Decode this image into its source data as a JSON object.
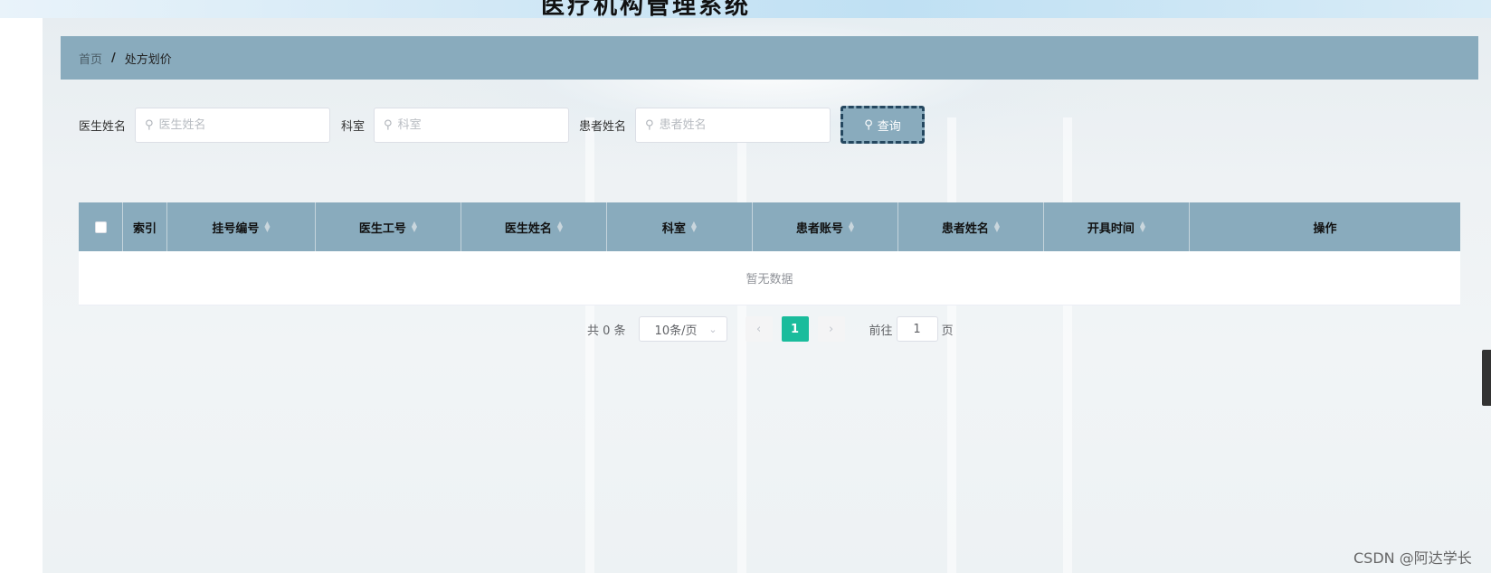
{
  "app": {
    "system_title": "医疗机构管理系统"
  },
  "breadcrumb": {
    "home": "首页",
    "separator": "/",
    "current": "处方划价"
  },
  "search": {
    "fields": [
      {
        "label": "医生姓名",
        "placeholder": "医生姓名",
        "value": ""
      },
      {
        "label": "科室",
        "placeholder": "科室",
        "value": ""
      },
      {
        "label": "患者姓名",
        "placeholder": "患者姓名",
        "value": ""
      }
    ],
    "query_button": "查询"
  },
  "table": {
    "columns": [
      {
        "label": "索引",
        "sortable": false
      },
      {
        "label": "挂号编号",
        "sortable": true
      },
      {
        "label": "医生工号",
        "sortable": true
      },
      {
        "label": "医生姓名",
        "sortable": true
      },
      {
        "label": "科室",
        "sortable": true
      },
      {
        "label": "患者账号",
        "sortable": true
      },
      {
        "label": "患者姓名",
        "sortable": true
      },
      {
        "label": "开具时间",
        "sortable": true
      },
      {
        "label": "操作",
        "sortable": false
      }
    ],
    "rows": [],
    "empty_text": "暂无数据"
  },
  "pagination": {
    "total_text": "共 0 条",
    "page_size": "10条/页",
    "current_page": "1",
    "goto_label": "前往",
    "goto_value": "1",
    "page_unit": "页"
  },
  "watermark": "CSDN @阿达学长",
  "colors": {
    "header_bar": "#89abbd",
    "active_page": "#1abc9c",
    "query_border": "#24475f"
  }
}
